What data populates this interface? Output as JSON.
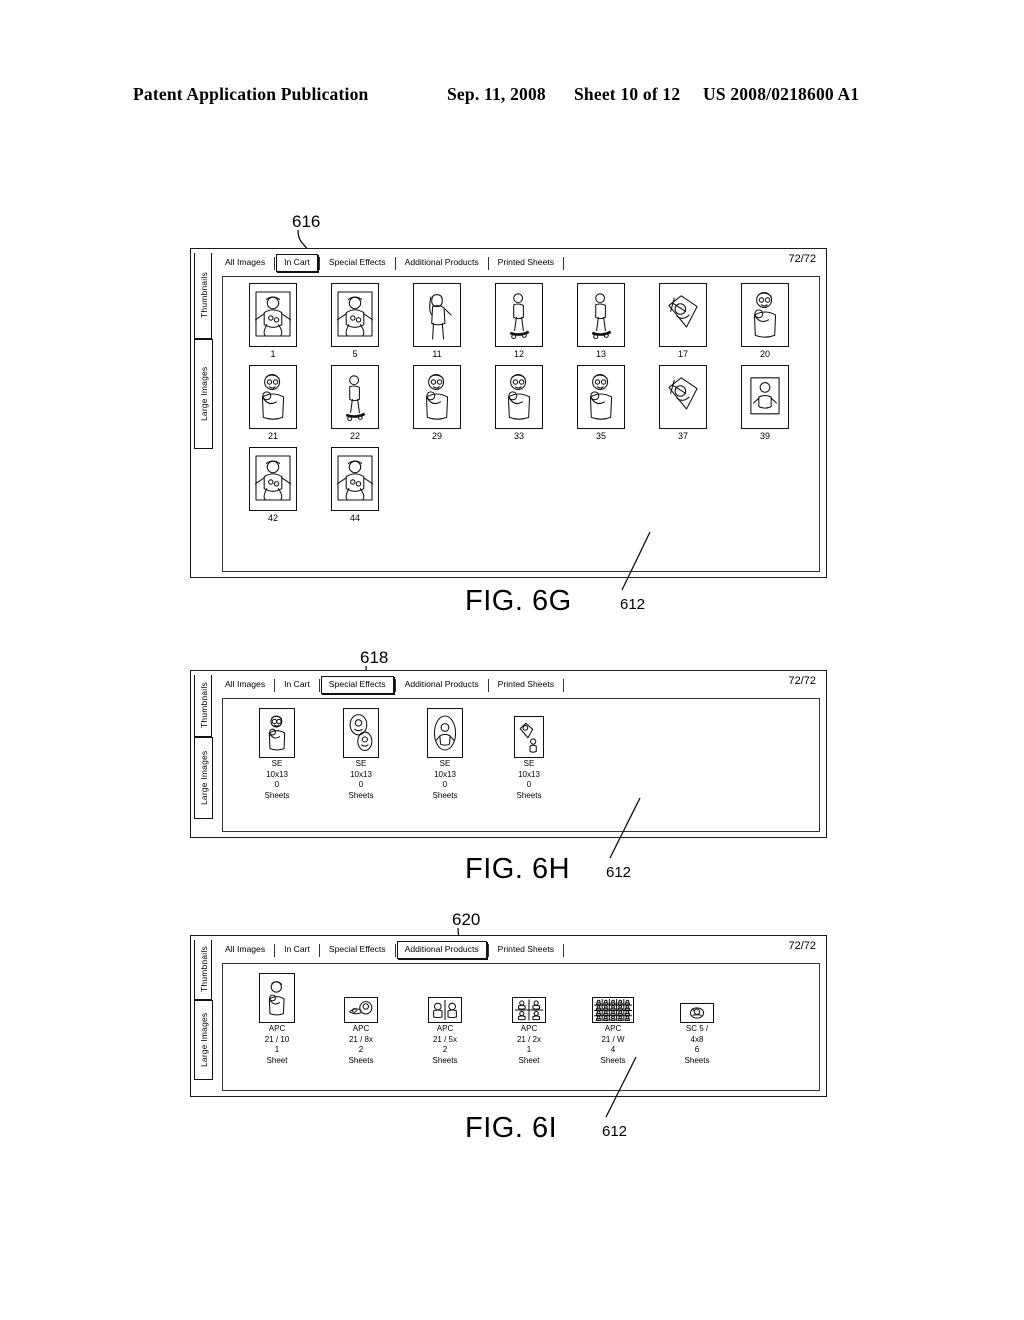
{
  "header": {
    "title": "Patent Application Publication",
    "date": "Sep. 11, 2008",
    "sheet": "Sheet 10 of 12",
    "patent_number": "US 2008/0218600 A1"
  },
  "toolbar_tabs": [
    "All Images",
    "In Cart",
    "Special Effects",
    "Additional Products",
    "Printed Sheets"
  ],
  "vertical_tabs": [
    "Thumbnails",
    "Large Images"
  ],
  "counter": "72/72",
  "figures": [
    {
      "id": "fig6g",
      "caption": "FIG. 6G",
      "figure_ref": "612",
      "callout": "616",
      "selected_tab": "In Cart",
      "counter": "72/72",
      "thumbnails": [
        {
          "label": "1",
          "art": "baby-on-blanket"
        },
        {
          "label": "5",
          "art": "baby-on-blanket"
        },
        {
          "label": "11",
          "art": "girl-standing"
        },
        {
          "label": "12",
          "art": "girl-skateboard"
        },
        {
          "label": "13",
          "art": "girl-skateboard"
        },
        {
          "label": "17",
          "art": "collage"
        },
        {
          "label": "20",
          "art": "mother-and-child"
        },
        {
          "label": "21",
          "art": "mother-and-child"
        },
        {
          "label": "22",
          "art": "girl-skateboard"
        },
        {
          "label": "29",
          "art": "mother-and-child"
        },
        {
          "label": "33",
          "art": "mother-and-child"
        },
        {
          "label": "35",
          "art": "mother-and-child"
        },
        {
          "label": "37",
          "art": "collage"
        },
        {
          "label": "39",
          "art": "baby-small"
        },
        {
          "label": "42",
          "art": "baby-on-blanket"
        },
        {
          "label": "44",
          "art": "baby-on-blanket"
        }
      ]
    },
    {
      "id": "fig6h",
      "caption": "FIG. 6H",
      "figure_ref": "612",
      "callout": "618",
      "selected_tab": "Special Effects",
      "counter": "72/72",
      "products": [
        {
          "code": "SE",
          "size": "10x13",
          "qty": "0",
          "unit": "Sheets",
          "art": "mother-and-child"
        },
        {
          "code": "SE",
          "size": "10x13",
          "qty": "0",
          "unit": "Sheets",
          "art": "two-ovals"
        },
        {
          "code": "SE",
          "size": "10x13",
          "qty": "0",
          "unit": "Sheets",
          "art": "oval-vignette"
        },
        {
          "code": "SE",
          "size": "10x13",
          "qty": "0",
          "unit": "Sheets",
          "art": "two-small"
        }
      ]
    },
    {
      "id": "fig6i",
      "caption": "FIG. 6I",
      "figure_ref": "612",
      "callout": "620",
      "selected_tab": "Additional Products",
      "counter": "72/72",
      "products": [
        {
          "code": "APC",
          "size": "21 / 10",
          "qty": "1",
          "unit": "Sheet",
          "art": "single-portrait"
        },
        {
          "code": "APC",
          "size": "21 / 8x",
          "qty": "2",
          "unit": "Sheets",
          "art": "landscape-pair"
        },
        {
          "code": "APC",
          "size": "21 / 5x",
          "qty": "2",
          "unit": "Sheets",
          "art": "two-up"
        },
        {
          "code": "APC",
          "size": "21 / 2x",
          "qty": "1",
          "unit": "Sheet",
          "art": "four-up"
        },
        {
          "code": "APC",
          "size": "21 / W",
          "qty": "4",
          "unit": "Sheets",
          "art": "wallet-grid"
        },
        {
          "code": "SC 5 /",
          "size": "4x8",
          "qty": "6",
          "unit": "Sheets",
          "art": "small-oval"
        }
      ]
    }
  ]
}
